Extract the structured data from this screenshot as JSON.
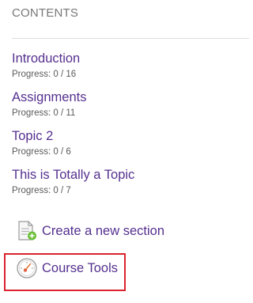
{
  "contents": {
    "heading": "CONTENTS"
  },
  "sections": [
    {
      "title": "Introduction",
      "progress": "Progress: 0 / 16"
    },
    {
      "title": "Assignments",
      "progress": "Progress: 0 / 11"
    },
    {
      "title": "Topic 2",
      "progress": "Progress: 0 / 6"
    },
    {
      "title": "This is Totally a Topic",
      "progress": "Progress: 0 / 7"
    }
  ],
  "actions": {
    "create_section_label": "Create a new section",
    "create_section_icon": "new-document-plus-icon",
    "course_tools_label": "Course Tools",
    "course_tools_icon": "gauge-dial-icon"
  },
  "colors": {
    "link": "#55308f",
    "heading": "#777777",
    "highlight": "#d9232e",
    "plus_badge": "#6cbf3a"
  }
}
